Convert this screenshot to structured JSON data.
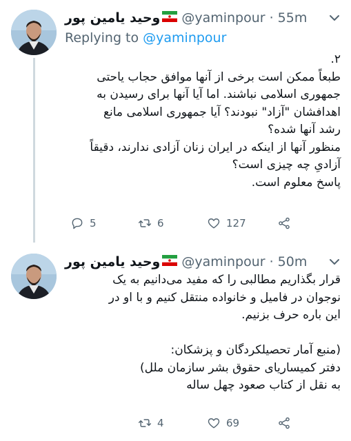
{
  "tweets": [
    {
      "author_name": "وحید یامین پور",
      "handle": "@yaminpour",
      "dot": "·",
      "time": "55m",
      "reply_to_prefix": "Replying to ",
      "reply_to_handle": "@yaminpour",
      "body_lines": [
        "۲.",
        "طبعاً ممکن است برخی از آنها موافق حجاب یاحتی",
        "جمهوری اسلامی نباشند. اما آیا آنها برای رسیدن به",
        "اهدافشان \"آزاد\" نبودند؟ آیا جمهوری اسلامی مانع",
        "رشد آنها شده؟",
        "منظور آنها از اینکه در ایران زنان آزادی ندارند، دقیقاً",
        "آزادیِ چه چیزی است؟",
        "پاسخ معلوم است."
      ],
      "actions": {
        "replies": "5",
        "retweets": "6",
        "likes": "127"
      }
    },
    {
      "author_name": "وحید یامین پور",
      "handle": "@yaminpour",
      "dot": "·",
      "time": "50m",
      "body_lines": [
        "قرار بگذاریم مطالبی را که مفید می‌دانیم به یک",
        "نوجوان در فامیل و خانواده منتقل کنیم و با او در",
        "این باره حرف بزنیم.",
        "",
        "(منبع آمار تحصیلکردگان و پزشکان:",
        "دفتر کمیساریای حقوق بشر سازمان ملل)",
        "به نقل از کتاب صعود چهل ساله"
      ],
      "actions": {
        "retweets": "4",
        "likes": "69"
      }
    }
  ],
  "icons": {
    "flag": "iran-flag-icon",
    "reply": "reply-icon",
    "retweet": "retweet-icon",
    "like": "heart-icon",
    "share": "share-icon",
    "more": "chevron-down-icon"
  },
  "colors": {
    "text": "#0f1419",
    "secondary": "#536471",
    "link": "#1d9bf0",
    "thread_line": "#cfd9de",
    "background": "#ffffff"
  }
}
